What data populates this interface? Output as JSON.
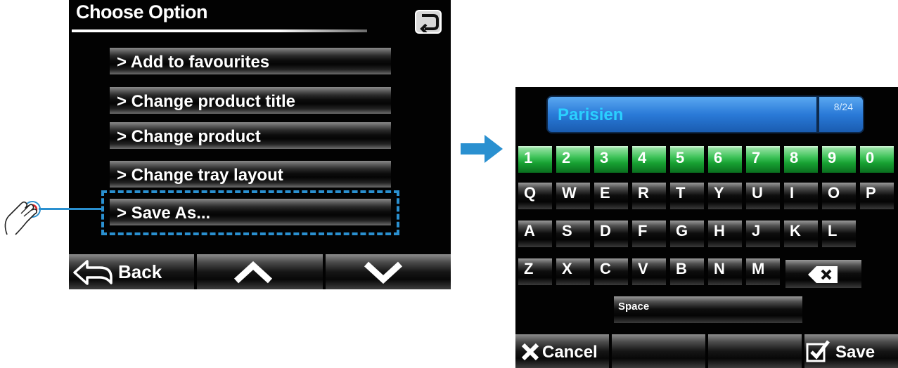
{
  "left_screen": {
    "title": "Choose Option",
    "return_icon": "return-arrow-icon",
    "menu": [
      {
        "label": "> Add to favourites"
      },
      {
        "label": "> Change product title"
      },
      {
        "label": "> Change product"
      },
      {
        "label": "> Change tray layout"
      },
      {
        "label": "> Save As..."
      }
    ],
    "highlighted_item": "> Save As...",
    "bottom_bar": {
      "back_label": "Back",
      "up_icon": "chevron-up-icon",
      "down_icon": "chevron-down-icon"
    }
  },
  "callout": {
    "icon": "hand-tap-icon",
    "color": "#2a90d0"
  },
  "transition_arrow": {
    "icon": "arrow-right-icon",
    "color": "#2a90d0"
  },
  "right_screen": {
    "text_field": {
      "value": "Parisien",
      "counter": "8/24"
    },
    "keyboard": {
      "digits": [
        "1",
        "2",
        "3",
        "4",
        "5",
        "6",
        "7",
        "8",
        "9",
        "0"
      ],
      "row1": [
        "Q",
        "W",
        "E",
        "R",
        "T",
        "Y",
        "U",
        "I",
        "O",
        "P"
      ],
      "row2": [
        "A",
        "S",
        "D",
        "F",
        "G",
        "H",
        "J",
        "K",
        "L"
      ],
      "row3": [
        "Z",
        "X",
        "C",
        "V",
        "B",
        "N",
        "M"
      ],
      "space_label": "Space",
      "backspace_icon": "backspace-icon"
    },
    "bottom_bar": {
      "cancel_label": "Cancel",
      "save_label": "Save"
    }
  },
  "colors": {
    "accent_blue": "#2a90d0",
    "digit_key_green": "#17a032",
    "text_field_blue": "#2a7ad8",
    "text_value_cyan": "#2ad0ff"
  }
}
